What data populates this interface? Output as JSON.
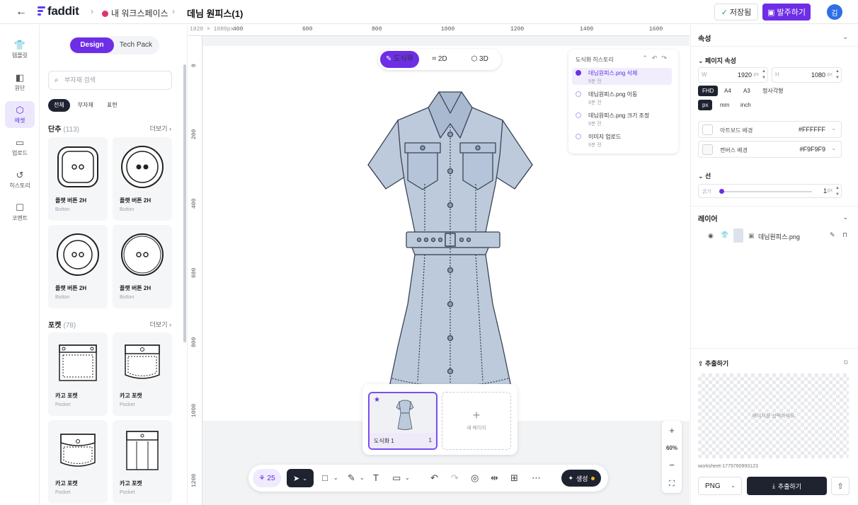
{
  "app": {
    "logo": "faddit",
    "breadcrumb_workspace": "내 워크스페이스",
    "document_title": "데님 원피스(1)",
    "saved_label": "저장됨",
    "order_label": "발주하기",
    "avatar_initial": "김"
  },
  "rail": [
    {
      "label": "템플릿",
      "icon": "shirt-icon"
    },
    {
      "label": "원단",
      "icon": "fabric-icon"
    },
    {
      "label": "에셋",
      "icon": "cube-icon"
    },
    {
      "label": "업로드",
      "icon": "folder-icon"
    },
    {
      "label": "히스토리",
      "icon": "history-icon"
    },
    {
      "label": "코멘트",
      "icon": "comment-icon"
    }
  ],
  "library": {
    "tabs": [
      "Design",
      "Tech Pack"
    ],
    "search_placeholder": "부자재 검색",
    "chips": [
      "전체",
      "부자재",
      "표현"
    ],
    "buttons_section": {
      "title": "단추",
      "count": "(113)",
      "more": "더보기"
    },
    "pockets_section": {
      "title": "포켓",
      "count": "(78)",
      "more": "더보기"
    },
    "button_items": [
      {
        "name": "플랫 버튼 2H",
        "sub": "Button"
      },
      {
        "name": "플랫 버튼 2H",
        "sub": "Button"
      },
      {
        "name": "플랫 버튼 2H",
        "sub": "Button"
      },
      {
        "name": "플랫 버튼 2H",
        "sub": "Button"
      }
    ],
    "pocket_items": [
      {
        "name": "카고 포켓",
        "sub": "Pocket"
      },
      {
        "name": "카고 포켓",
        "sub": "Pocket"
      },
      {
        "name": "카고 포켓",
        "sub": "Pocket"
      },
      {
        "name": "카고 포켓",
        "sub": "Pocket"
      }
    ]
  },
  "canvas": {
    "size_label": "1920 × 1080px",
    "ruler_top": [
      "400",
      "600",
      "800",
      "1000",
      "1200",
      "1400",
      "1600"
    ],
    "ruler_left": [
      "0",
      "200",
      "400",
      "600",
      "800",
      "1000",
      "1200"
    ],
    "view_toggle": [
      "도식화",
      "2D",
      "3D"
    ],
    "history": {
      "title": "도식화 히스토리",
      "items": [
        {
          "text": "데님원피스.png 삭제",
          "time": "9분 전"
        },
        {
          "text": "데님원피스.png 이동",
          "time": "9분 전"
        },
        {
          "text": "데님원피스.png 크기 조정",
          "time": "9분 전"
        },
        {
          "text": "이미지 업로드",
          "time": "9분 전"
        }
      ]
    },
    "pages": [
      {
        "label": "도식화 1",
        "num": "1"
      }
    ],
    "new_page_label": "새 페이지",
    "zoom": "60%",
    "credits": "25",
    "generate_label": "생성"
  },
  "props": {
    "title": "속성",
    "page_props": "페이지 속성",
    "width_label": "W",
    "width": "1920",
    "height_label": "H",
    "height": "1080",
    "unit": "px",
    "presets": [
      "FHD",
      "A4",
      "A3",
      "정사각형"
    ],
    "units": [
      "px",
      "mm",
      "inch"
    ],
    "artboard_bg_label": "아트보드 배경",
    "artboard_bg": "#FFFFFF",
    "canvas_bg_label": "캔버스 배경",
    "canvas_bg": "#F9F9F9",
    "line_section": "선",
    "thickness_label": "굵기",
    "thickness": "1",
    "layers_title": "레이어",
    "layer_name": "데님원피스.png",
    "export_title": "추출하기",
    "export_msg": "페이지를 선택하세요",
    "worksheet_id": "worksheet-1779760993123",
    "format": "PNG",
    "download_label": "추출하기"
  },
  "colors": {
    "accent": "#6d2ee6",
    "denim": "#bccadc",
    "dark": "#1f2330"
  }
}
